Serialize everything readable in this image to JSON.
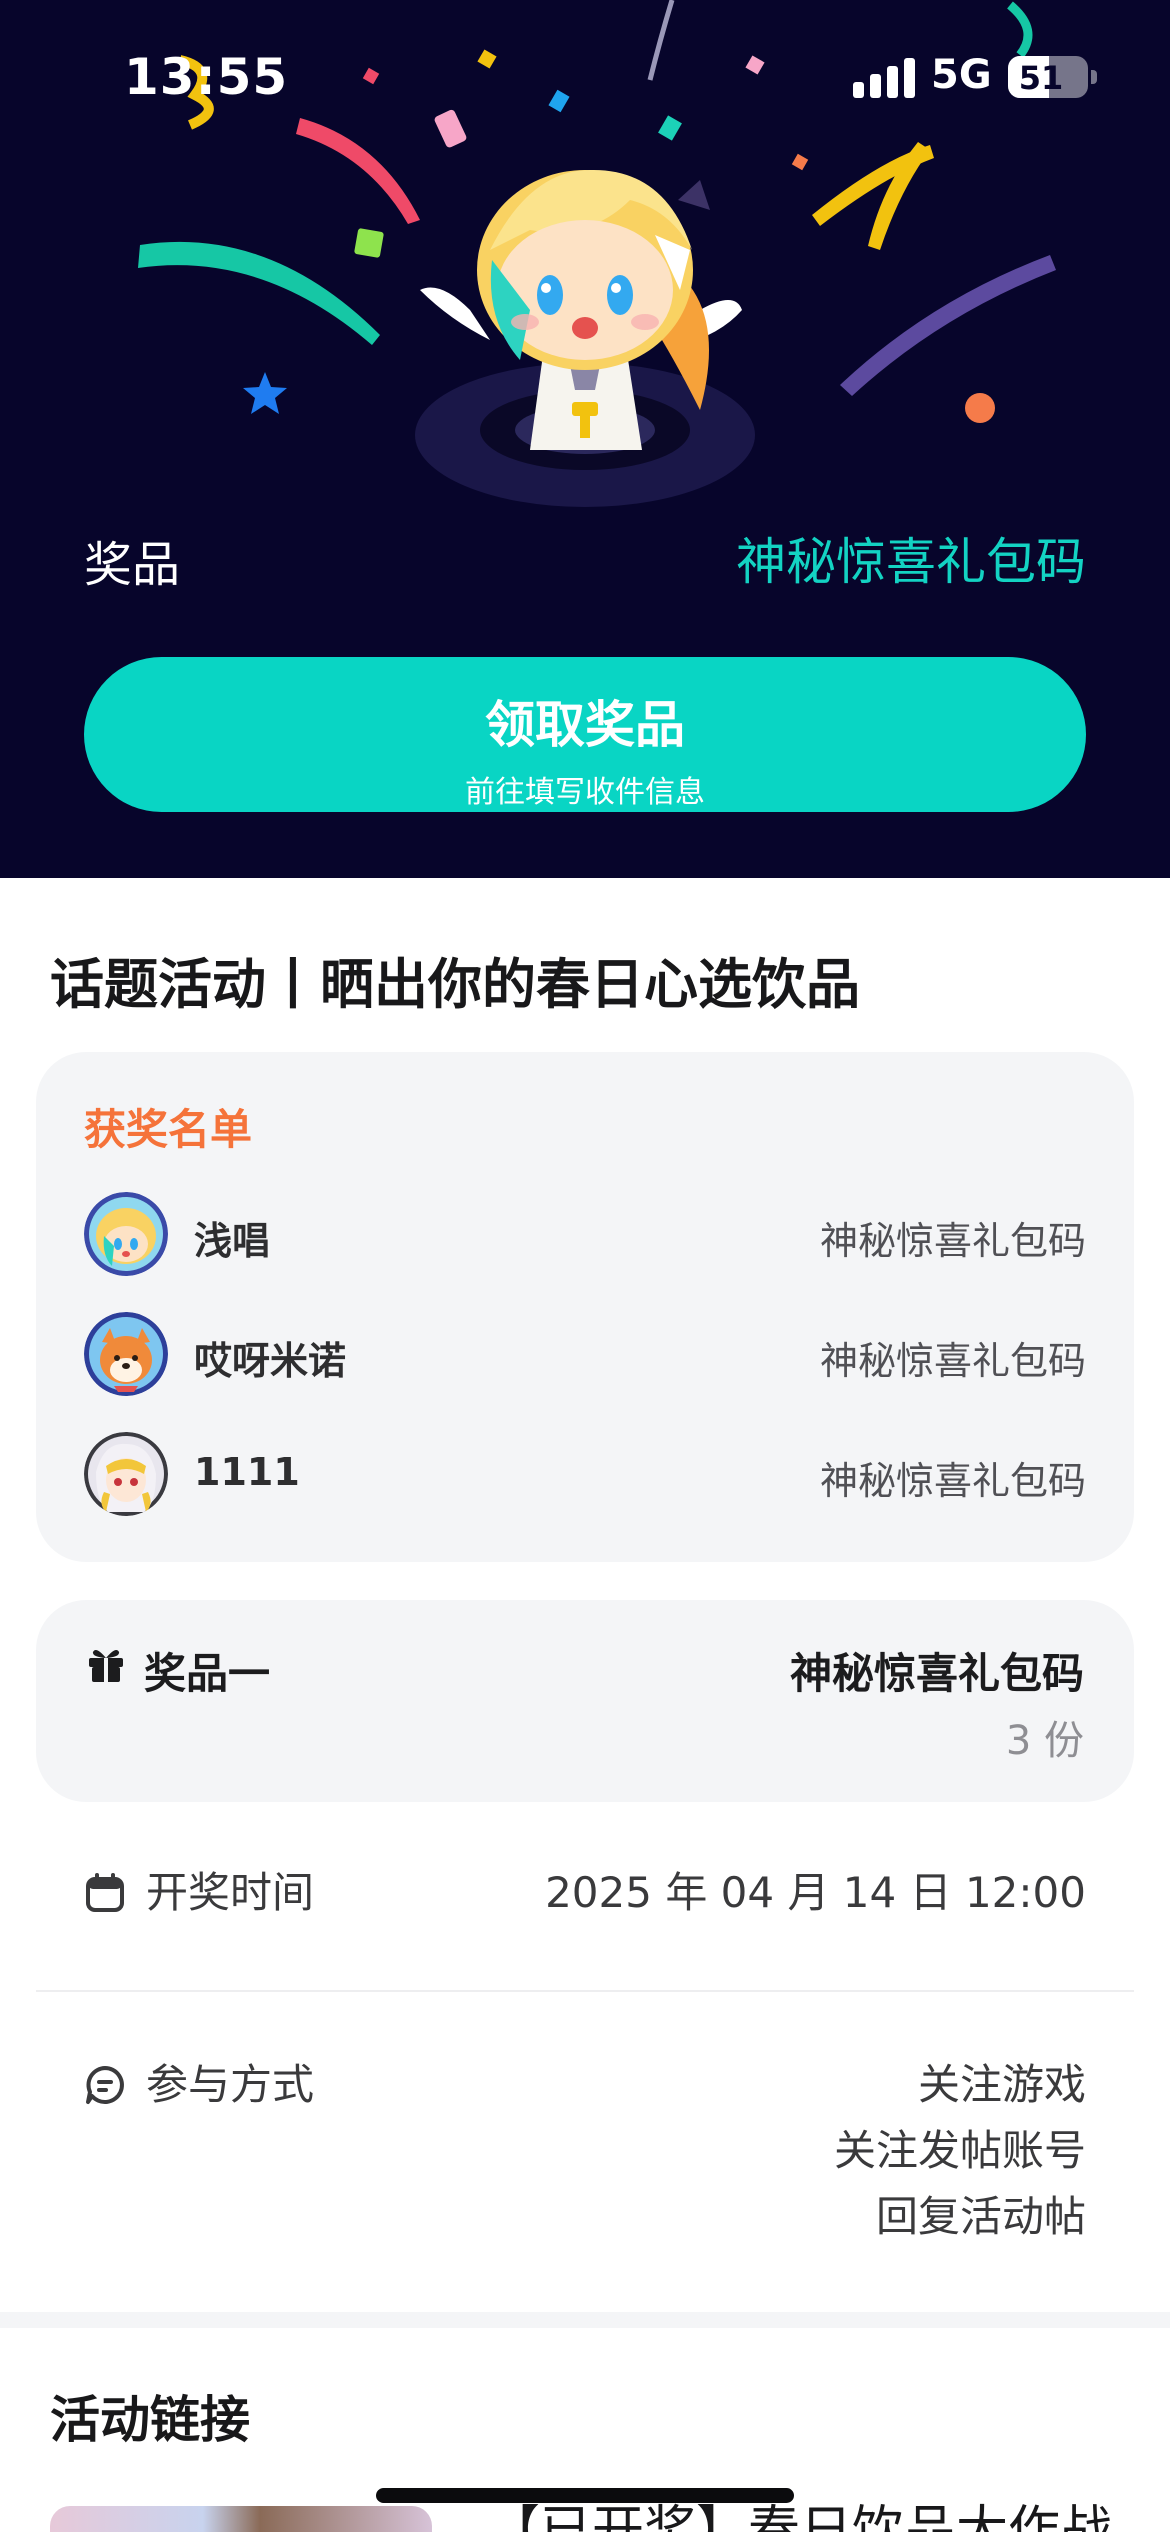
{
  "status_bar": {
    "time": "13:55",
    "network": "5G",
    "battery": "51",
    "battery_level": 0.51
  },
  "hero": {
    "prize_label": "奖品",
    "prize_value": "神秘惊喜礼包码",
    "claim_button": {
      "title": "领取奖品",
      "subtitle": "前往填写收件信息"
    },
    "colors": {
      "background": "#07052b",
      "accent": "#09d5c4"
    }
  },
  "topic": {
    "title": "话题活动丨晒出你的春日心选饮品"
  },
  "winners": {
    "heading": "获奖名单",
    "list": [
      {
        "name": "浅唱",
        "prize": "神秘惊喜礼包码",
        "avatar": "mascot-avatar"
      },
      {
        "name": "哎呀米诺",
        "prize": "神秘惊喜礼包码",
        "avatar": "shiba-avatar"
      },
      {
        "name": "1111",
        "prize": "神秘惊喜礼包码",
        "avatar": "anime-girl-avatar"
      }
    ]
  },
  "prize": {
    "label": "奖品一",
    "value": "神秘惊喜礼包码",
    "count": "3 份",
    "icon": "gift-icon"
  },
  "draw_time": {
    "label": "开奖时间",
    "value": "2025 年 04 月 14 日 12:00",
    "icon": "calendar-icon"
  },
  "participation": {
    "label": "参与方式",
    "icon": "chat-icon",
    "steps": [
      "关注游戏",
      "关注发帖账号",
      "回复活动帖"
    ]
  },
  "links": {
    "title": "活动链接",
    "first_item_text": "【已开奖】春日饮品大作战"
  }
}
